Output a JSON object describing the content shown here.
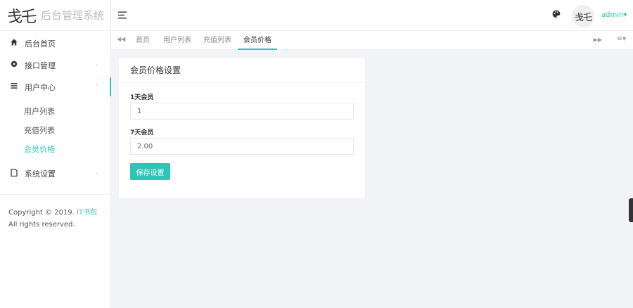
{
  "app": {
    "logo_mark": "戋乇",
    "title": "后台管理系统"
  },
  "header": {
    "user": "admin▾",
    "avatar_text": "戋乇"
  },
  "sidebar": {
    "items": [
      {
        "label": "后台首页",
        "icon": "home-icon"
      },
      {
        "label": "接口管理",
        "icon": "settings-icon"
      },
      {
        "label": "用户中心",
        "icon": "list-icon"
      },
      {
        "label": "系统设置",
        "icon": "file-icon"
      }
    ],
    "sub_items": [
      {
        "label": "用户列表"
      },
      {
        "label": "充值列表"
      },
      {
        "label": "会员价格",
        "active": true
      }
    ],
    "copyright": {
      "prefix": "Copyright © 2019.",
      "brand": "IT书包",
      "suffix": "All rights reserved."
    }
  },
  "tabs": [
    "首页",
    "用户列表",
    "充值列表",
    "会员价格"
  ],
  "active_tab": "会员价格",
  "card": {
    "title": "会员价格设置",
    "fields": [
      {
        "label": "1天会员",
        "value": "1"
      },
      {
        "label": "7天会员",
        "value": "2.00"
      }
    ],
    "save_label": "保存设置"
  },
  "colors": {
    "accent": "#2ec5b6",
    "background": "#f2f3f6"
  }
}
